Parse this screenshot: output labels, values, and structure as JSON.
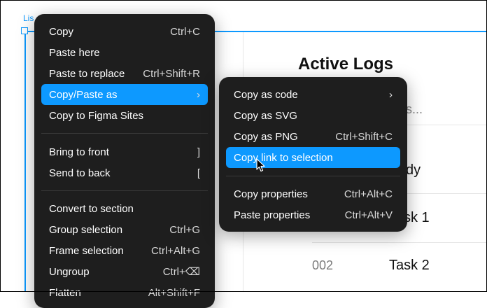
{
  "canvas": {
    "frame_label": "Lis",
    "heading": "Active Logs",
    "search_placeholder_fragment": "s...",
    "row1_fragment": "dy",
    "row2_fragment": "sk 1",
    "row3_id": "002",
    "row3_task": "Task 2"
  },
  "main_menu": {
    "items": [
      {
        "label": "Copy",
        "shortcut": "Ctrl+C"
      },
      {
        "label": "Paste here",
        "shortcut": ""
      },
      {
        "label": "Paste to replace",
        "shortcut": "Ctrl+Shift+R"
      },
      {
        "label": "Copy/Paste as",
        "shortcut": "›"
      },
      {
        "label": "Copy to Figma Sites",
        "shortcut": ""
      },
      {
        "label": "Bring to front",
        "shortcut": "]"
      },
      {
        "label": "Send to back",
        "shortcut": "["
      },
      {
        "label": "Convert to section",
        "shortcut": ""
      },
      {
        "label": "Group selection",
        "shortcut": "Ctrl+G"
      },
      {
        "label": "Frame selection",
        "shortcut": "Ctrl+Alt+G"
      },
      {
        "label": "Ungroup",
        "shortcut": "Ctrl+⌫"
      },
      {
        "label": "Flatten",
        "shortcut": "Alt+Shift+F"
      }
    ]
  },
  "sub_menu": {
    "items": [
      {
        "label": "Copy as code",
        "shortcut": "›"
      },
      {
        "label": "Copy as SVG",
        "shortcut": ""
      },
      {
        "label": "Copy as PNG",
        "shortcut": "Ctrl+Shift+C"
      },
      {
        "label": "Copy link to selection",
        "shortcut": ""
      },
      {
        "label": "Copy properties",
        "shortcut": "Ctrl+Alt+C"
      },
      {
        "label": "Paste properties",
        "shortcut": "Ctrl+Alt+V"
      }
    ]
  },
  "colors": {
    "accent": "#0d99ff",
    "menu_bg": "#1e1e1e"
  },
  "icons": {
    "cursor": "pointer-cursor-icon",
    "submenu": "chevron-right-icon"
  }
}
